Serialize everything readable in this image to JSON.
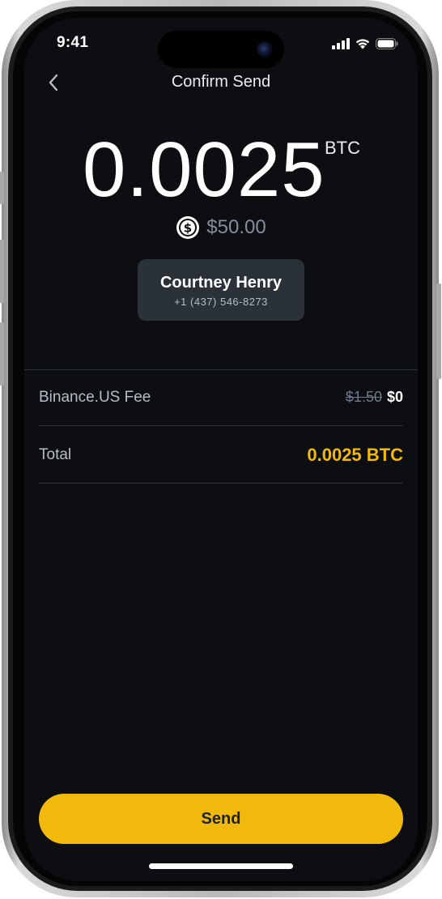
{
  "status_bar": {
    "time": "9:41"
  },
  "nav": {
    "title": "Confirm Send",
    "back_icon": "chevron-left-icon"
  },
  "amount": {
    "value": "0.0025",
    "unit": "BTC",
    "fiat_icon": "usd-coin-icon",
    "fiat_value": "$50.00"
  },
  "recipient": {
    "name": "Courtney Henry",
    "phone": "+1 (437) 546-8273"
  },
  "details": {
    "fee_label": "Binance.US Fee",
    "fee_original": "$1.50",
    "fee_current": "$0",
    "total_label": "Total",
    "total_value": "0.0025 BTC"
  },
  "actions": {
    "send_label": "Send"
  },
  "colors": {
    "background": "#0c0e11",
    "accent": "#f0b90b",
    "card": "#2b3139",
    "muted_text": "#848e9c"
  }
}
